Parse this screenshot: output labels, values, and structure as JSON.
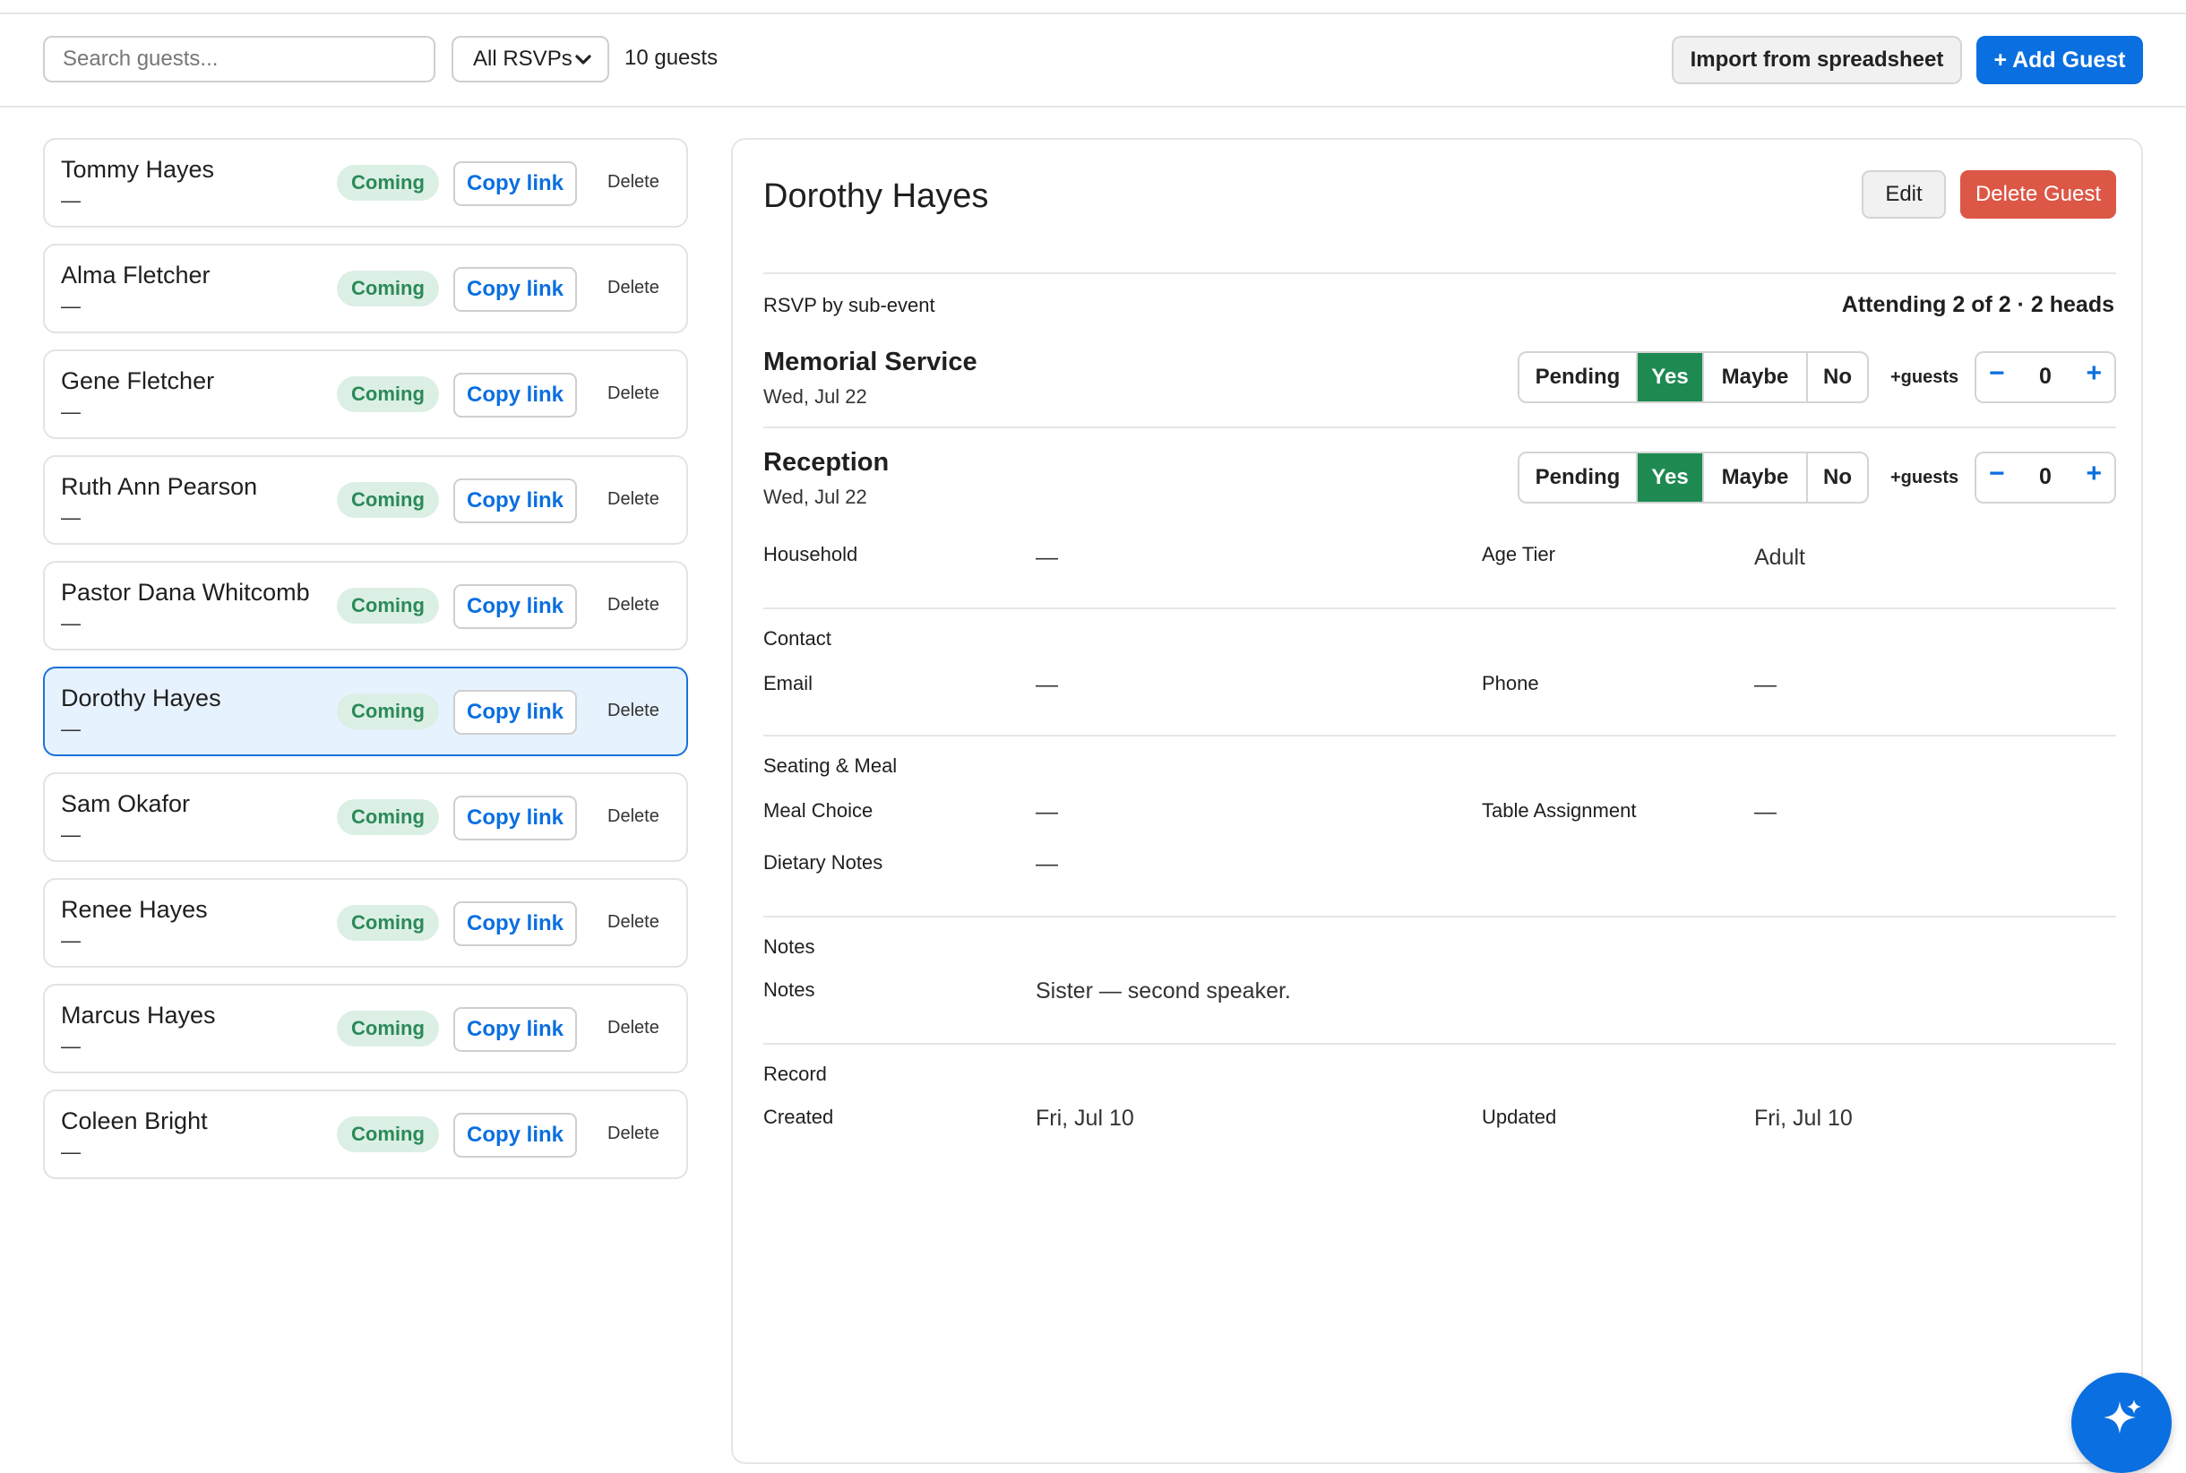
{
  "toolbar": {
    "search_placeholder": "Search guests...",
    "rsvp_filter": "All RSVPs",
    "guest_count": "10 guests",
    "import_label": "Import from spreadsheet",
    "add_label": "+ Add Guest"
  },
  "guests": [
    {
      "name": "Tommy Hayes",
      "sub": "—",
      "status": "Coming",
      "copy": "Copy link",
      "delete": "Delete"
    },
    {
      "name": "Alma Fletcher",
      "sub": "—",
      "status": "Coming",
      "copy": "Copy link",
      "delete": "Delete"
    },
    {
      "name": "Gene Fletcher",
      "sub": "—",
      "status": "Coming",
      "copy": "Copy link",
      "delete": "Delete"
    },
    {
      "name": "Ruth Ann Pearson",
      "sub": "—",
      "status": "Coming",
      "copy": "Copy link",
      "delete": "Delete"
    },
    {
      "name": "Pastor Dana Whitcomb",
      "sub": "—",
      "status": "Coming",
      "copy": "Copy link",
      "delete": "Delete"
    },
    {
      "name": "Dorothy Hayes",
      "sub": "—",
      "status": "Coming",
      "copy": "Copy link",
      "delete": "Delete",
      "selected": true
    },
    {
      "name": "Sam Okafor",
      "sub": "—",
      "status": "Coming",
      "copy": "Copy link",
      "delete": "Delete"
    },
    {
      "name": "Renee Hayes",
      "sub": "—",
      "status": "Coming",
      "copy": "Copy link",
      "delete": "Delete"
    },
    {
      "name": "Marcus Hayes",
      "sub": "—",
      "status": "Coming",
      "copy": "Copy link",
      "delete": "Delete"
    },
    {
      "name": "Coleen Bright",
      "sub": "—",
      "status": "Coming",
      "copy": "Copy link",
      "delete": "Delete"
    }
  ],
  "detail": {
    "title": "Dorothy Hayes",
    "edit_label": "Edit",
    "delete_label": "Delete Guest",
    "rsvp_heading": "RSVP by sub-event",
    "attending_summary": "Attending 2 of 2 · 2 heads",
    "rsvp_options": [
      "Pending",
      "Yes",
      "Maybe",
      "No"
    ],
    "plus_guests_label": "+guests",
    "events": [
      {
        "name": "Memorial Service",
        "date": "Wed, Jul 22",
        "selected": "Yes",
        "plus_guests": "0"
      },
      {
        "name": "Reception",
        "date": "Wed, Jul 22",
        "selected": "Yes",
        "plus_guests": "0"
      }
    ],
    "household": {
      "label": "Household",
      "value": "—"
    },
    "age_tier": {
      "label": "Age Tier",
      "value": "Adult"
    },
    "contact": {
      "title": "Contact",
      "email_label": "Email",
      "email_value": "—",
      "phone_label": "Phone",
      "phone_value": "—"
    },
    "seating": {
      "title": "Seating & Meal",
      "meal_label": "Meal Choice",
      "meal_value": "—",
      "table_label": "Table Assignment",
      "table_value": "—",
      "dietary_label": "Dietary Notes",
      "dietary_value": "—"
    },
    "notes": {
      "title": "Notes",
      "label": "Notes",
      "value": "Sister — second speaker."
    },
    "record": {
      "title": "Record",
      "created_label": "Created",
      "created_value": "Fri, Jul 10",
      "updated_label": "Updated",
      "updated_value": "Fri, Jul 10"
    }
  },
  "colors": {
    "primary": "#0a6fe0",
    "danger": "#dc5746",
    "success": "#1e8a52",
    "badge_bg": "#dcefe5",
    "selected_bg": "#e6f2fd"
  },
  "icons": {
    "select": "chevron-down-icon",
    "fab": "sparkle-icon"
  }
}
